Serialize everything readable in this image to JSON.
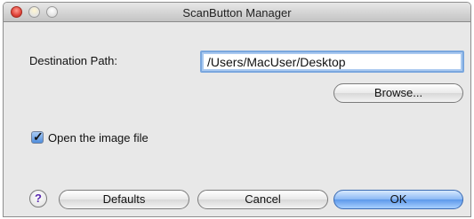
{
  "window": {
    "title": "ScanButton Manager"
  },
  "destination": {
    "label": "Destination Path:",
    "value": "/Users/MacUser/Desktop"
  },
  "buttons": {
    "browse": "Browse...",
    "defaults": "Defaults",
    "cancel": "Cancel",
    "ok": "OK",
    "help": "?"
  },
  "options": {
    "open_image_label": "Open the image file",
    "open_image_checked": true
  },
  "colors": {
    "accent": "#5d98ea",
    "focus_ring": "#7aa7de"
  },
  "icons": {
    "help": "help-icon",
    "check": "checkmark-icon"
  }
}
